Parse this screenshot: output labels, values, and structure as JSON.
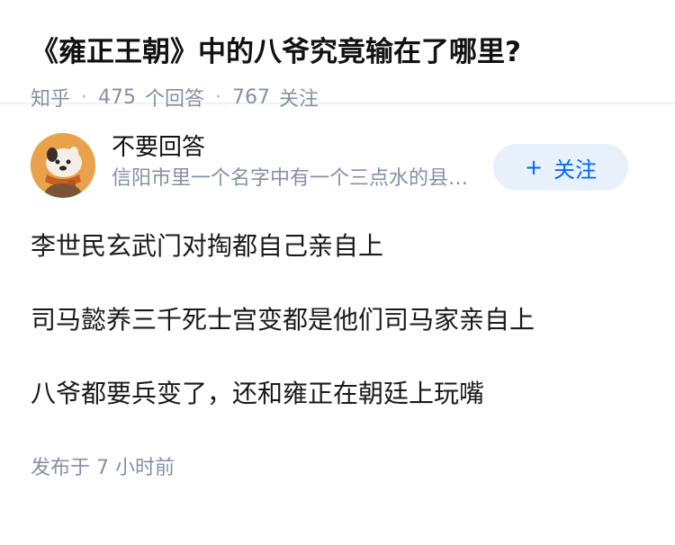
{
  "question": {
    "title": "《雍正王朝》中的八爷究竟输在了哪里?",
    "meta": {
      "source": "知乎",
      "answers_count": "475",
      "answers_label": "个回答",
      "followers_count": "767",
      "followers_label": "关注"
    }
  },
  "answer": {
    "author": {
      "name": "不要回答",
      "bio": "信阳市里一个名字中有一个三点水的县城..."
    },
    "follow_button": {
      "icon": "plus-icon",
      "label": "关注"
    },
    "paragraphs": [
      "李世民玄武门对掏都自己亲自上",
      "司马懿养三千死士宫变都是他们司马家亲自上",
      "八爷都要兵变了，还和雍正在朝廷上玩嘴"
    ],
    "published": "发布于  7 小时前"
  },
  "colors": {
    "title": "#121212",
    "meta": "#8590a6",
    "accent": "#0066ff",
    "follow_bg": "#e8f1fb",
    "avatar_bg": "#e9a24a"
  }
}
